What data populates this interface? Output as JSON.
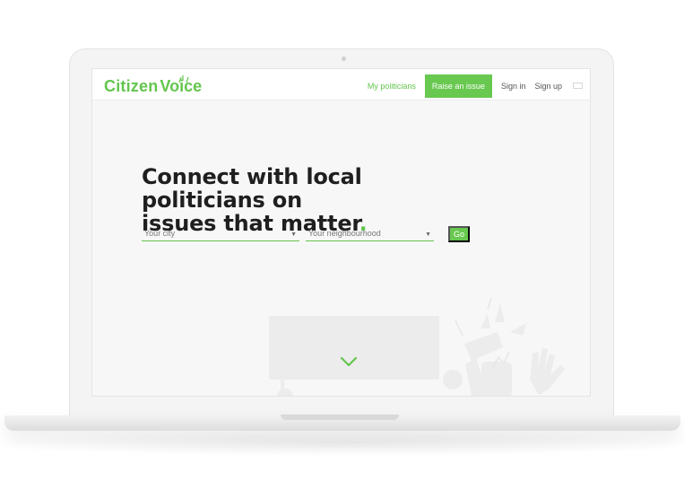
{
  "app": {
    "brand": {
      "name_prefix": "Citizen",
      "name_suffix": "Voice",
      "accent_color": "#63c54d",
      "icon": "megaphone-burst-icon"
    },
    "nav": {
      "my_politicians": "My politicians",
      "raise_issue": "Raise an issue",
      "sign_in": "Sign in",
      "sign_up": "Sign up",
      "language_icon": "uk-flag-icon"
    },
    "hero": {
      "headline_line1": "Connect with local politicians on",
      "headline_line2": "issues that matter",
      "headline_dot": ".",
      "city_placeholder": "Your city",
      "neighbourhood_placeholder": "Your neighbourhood",
      "go_label": "Go",
      "scroll_icon": "chevron-down-icon"
    },
    "colors": {
      "primary": "#68c84f",
      "text_dark": "#1f1f1f",
      "text_muted": "#777777",
      "screen_bg": "#f7f7f7"
    }
  }
}
